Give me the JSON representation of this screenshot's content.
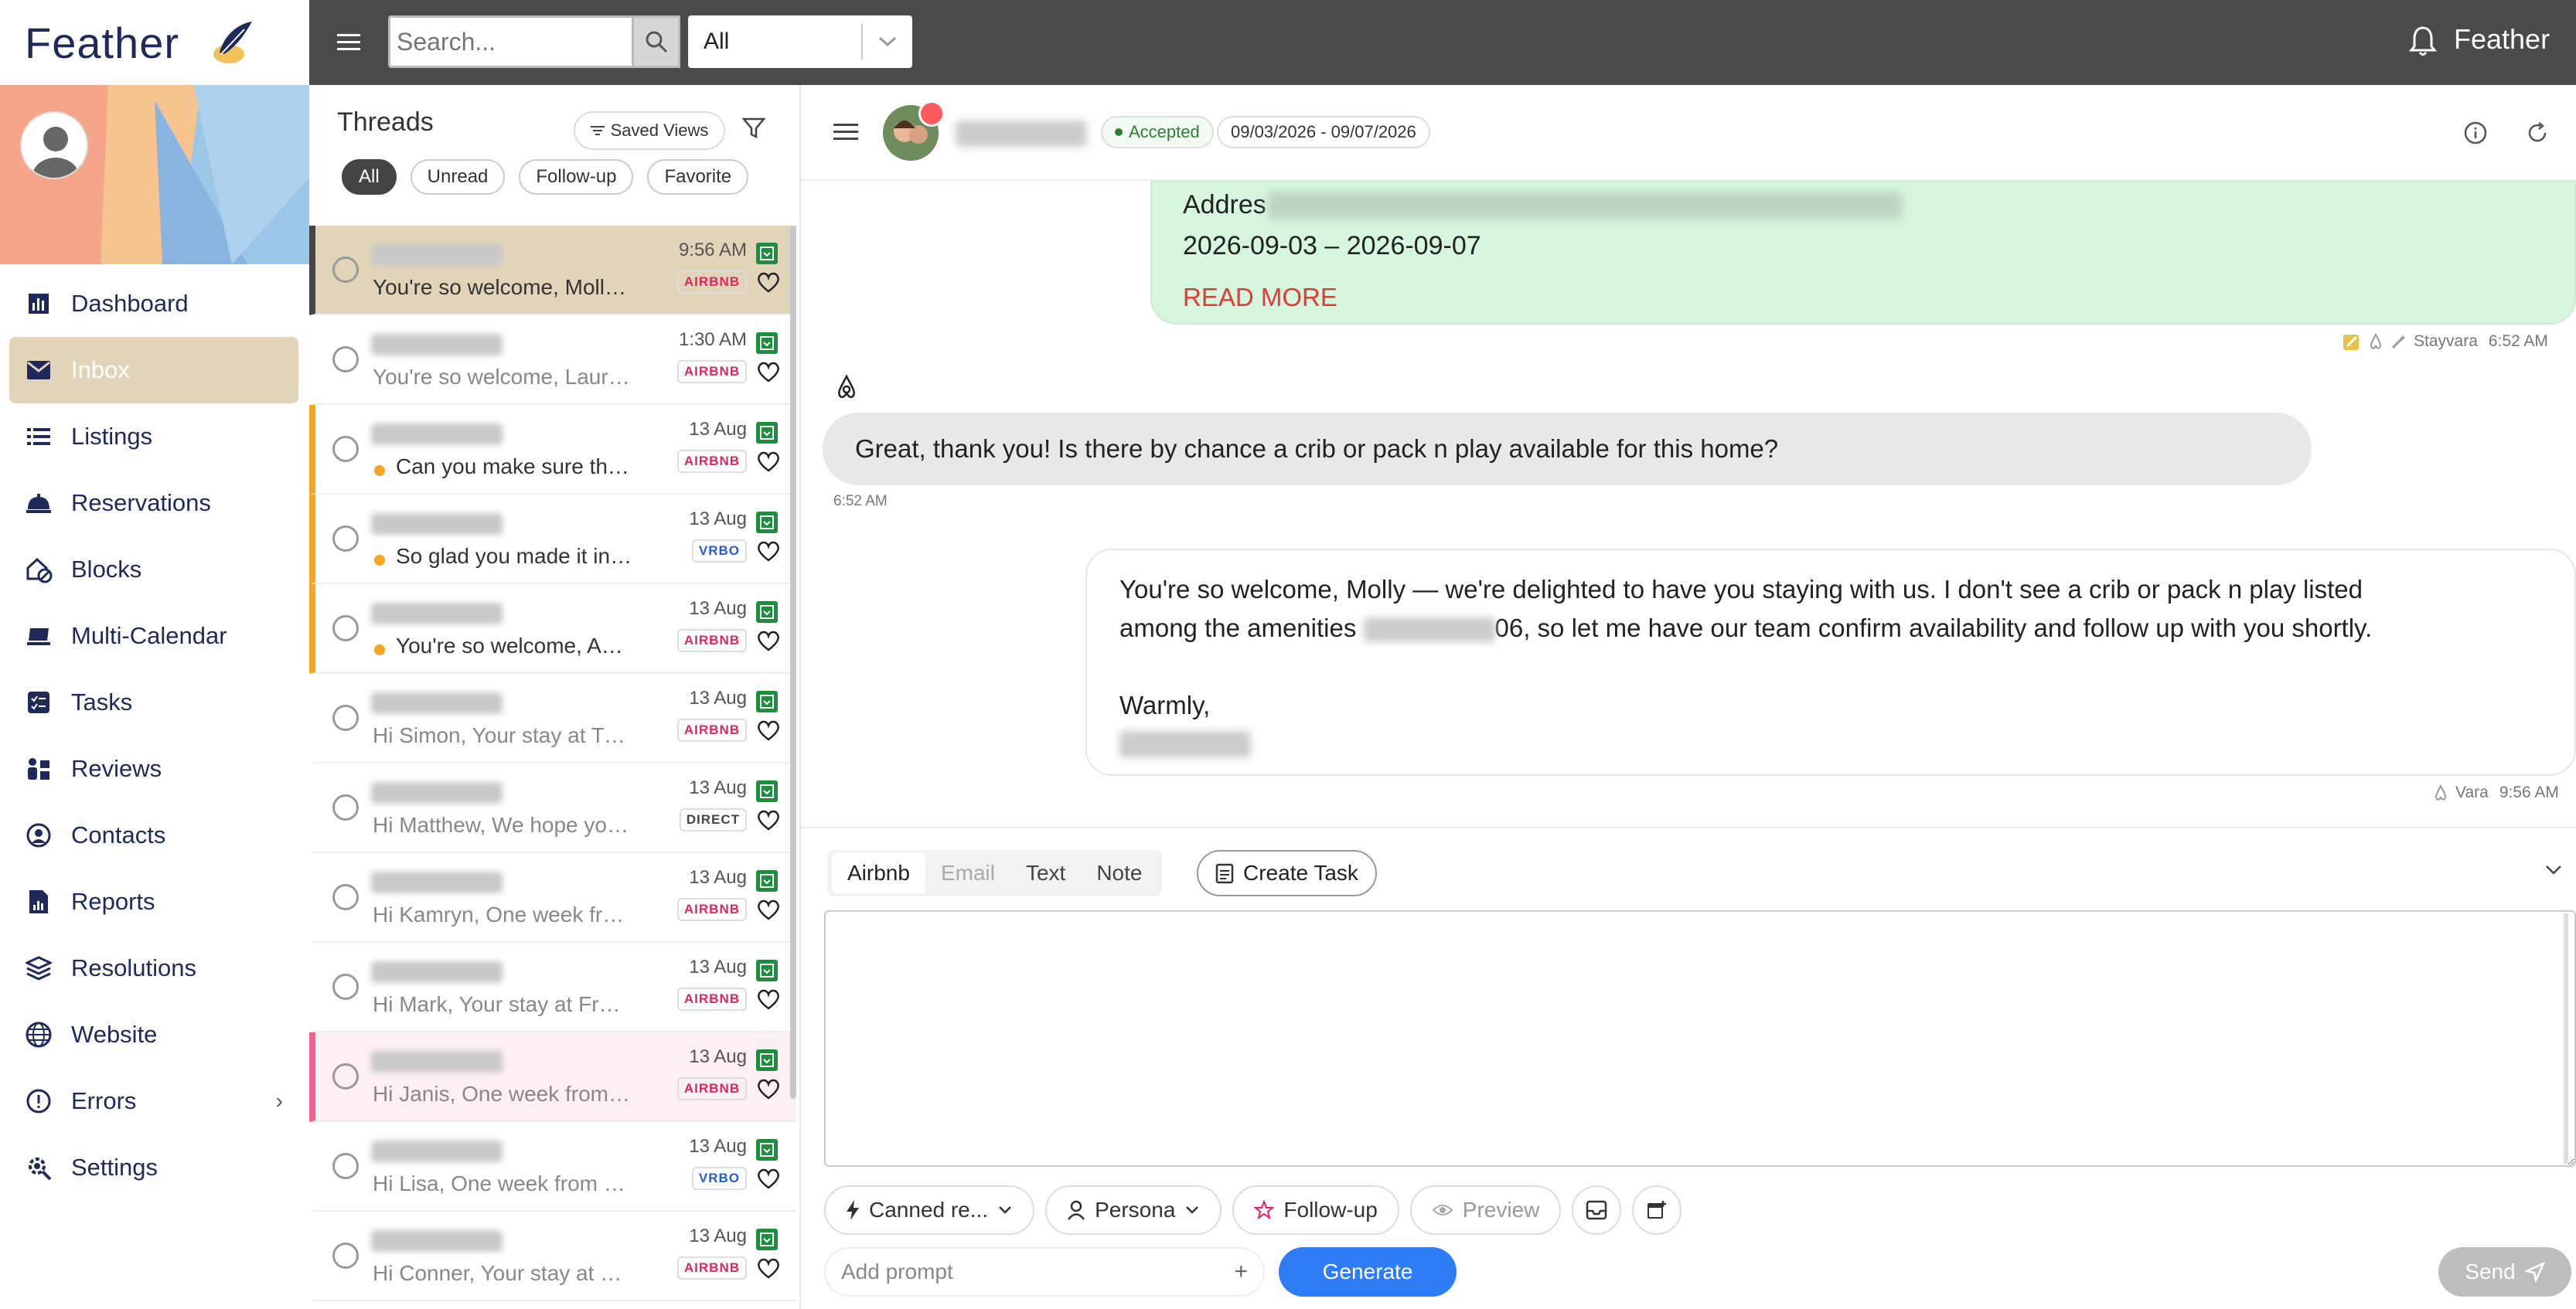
{
  "app": {
    "brand": "Feather",
    "user": "Feather"
  },
  "topbar": {
    "search_placeholder": "Search...",
    "filter_value": "All"
  },
  "sidebar": {
    "items": [
      {
        "label": "Dashboard",
        "icon": "bar-chart-icon"
      },
      {
        "label": "Inbox",
        "icon": "mail-icon",
        "active": true
      },
      {
        "label": "Listings",
        "icon": "list-icon"
      },
      {
        "label": "Reservations",
        "icon": "bell-service-icon"
      },
      {
        "label": "Blocks",
        "icon": "house-block-icon"
      },
      {
        "label": "Multi-Calendar",
        "icon": "calendar-icon"
      },
      {
        "label": "Tasks",
        "icon": "tasks-icon"
      },
      {
        "label": "Reviews",
        "icon": "reviews-icon"
      },
      {
        "label": "Contacts",
        "icon": "contact-icon"
      },
      {
        "label": "Reports",
        "icon": "report-icon"
      },
      {
        "label": "Resolutions",
        "icon": "layers-icon"
      },
      {
        "label": "Website",
        "icon": "globe-icon"
      },
      {
        "label": "Errors",
        "icon": "alert-circle-icon"
      },
      {
        "label": "Settings",
        "icon": "gear-icon"
      }
    ]
  },
  "threads": {
    "title": "Threads",
    "saved_views": "Saved Views",
    "chips": [
      "All",
      "Unread",
      "Follow-up",
      "Favorite"
    ],
    "list": [
      {
        "preview": "You're so welcome, Molly — ...",
        "time": "9:56 AM",
        "channel": "AIRBNB",
        "state": "sel"
      },
      {
        "preview": "You're so welcome, Laura —...",
        "time": "1:30 AM",
        "channel": "AIRBNB",
        "state": ""
      },
      {
        "preview": "Can you make sure there...",
        "time": "13 Aug",
        "channel": "AIRBNB",
        "state": "orange"
      },
      {
        "preview": "So glad you made it in saf...",
        "time": "13 Aug",
        "channel": "VRBO",
        "state": "orange"
      },
      {
        "preview": "You're so welcome, Aaro...",
        "time": "13 Aug",
        "channel": "AIRBNB",
        "state": "orange"
      },
      {
        "preview": "Hi Simon, Your stay at Trailh...",
        "time": "13 Aug",
        "channel": "AIRBNB",
        "state": ""
      },
      {
        "preview": "Hi Matthew, We hope you're...",
        "time": "13 Aug",
        "channel": "DIRECT",
        "state": ""
      },
      {
        "preview": "Hi Kamryn, One week from t...",
        "time": "13 Aug",
        "channel": "AIRBNB",
        "state": ""
      },
      {
        "preview": "Hi Mark, Your stay at Fraser ...",
        "time": "13 Aug",
        "channel": "AIRBNB",
        "state": ""
      },
      {
        "preview": "Hi Janis, One week from tod...",
        "time": "13 Aug",
        "channel": "AIRBNB",
        "state": "pink"
      },
      {
        "preview": "Hi Lisa, One week from today...",
        "time": "13 Aug",
        "channel": "VRBO",
        "state": ""
      },
      {
        "preview": "Hi Conner, Your stay at Exp...",
        "time": "13 Aug",
        "channel": "AIRBNB",
        "state": ""
      }
    ]
  },
  "conversation": {
    "status": "Accepted",
    "dates": "09/03/2026 - 09/07/2026",
    "host_message": {
      "address_prefix": "Addres",
      "date_range": "2026-09-03 – 2026-09-07",
      "read_more": "READ MORE",
      "sender": "Stayvara",
      "time": "6:52 AM"
    },
    "guest_message": {
      "text": "Great, thank you! Is there by chance a crib or pack n play available for this home?",
      "time": "6:52 AM"
    },
    "reply": {
      "line1": "You're so welcome, Molly — we're delighted to have you staying with us. I don't see a crib or pack n play listed",
      "line2a": "among the amenities ",
      "line2b": "06, so let me have our team confirm availability and follow up with you shortly.",
      "closing": "Warmly,",
      "sender": "Vara",
      "time": "9:56 AM"
    }
  },
  "composer": {
    "tabs": [
      "Airbnb",
      "Email",
      "Text",
      "Note"
    ],
    "create_task": "Create Task",
    "canned": "Canned re...",
    "persona": "Persona",
    "follow_up": "Follow-up",
    "preview": "Preview",
    "prompt_placeholder": "Add prompt",
    "generate": "Generate",
    "send": "Send"
  },
  "colors": {
    "accent": "#2f7df6",
    "active_bg": "#e2d4b8",
    "topbar": "#4a4a4a",
    "brand": "#1f2a5a"
  }
}
